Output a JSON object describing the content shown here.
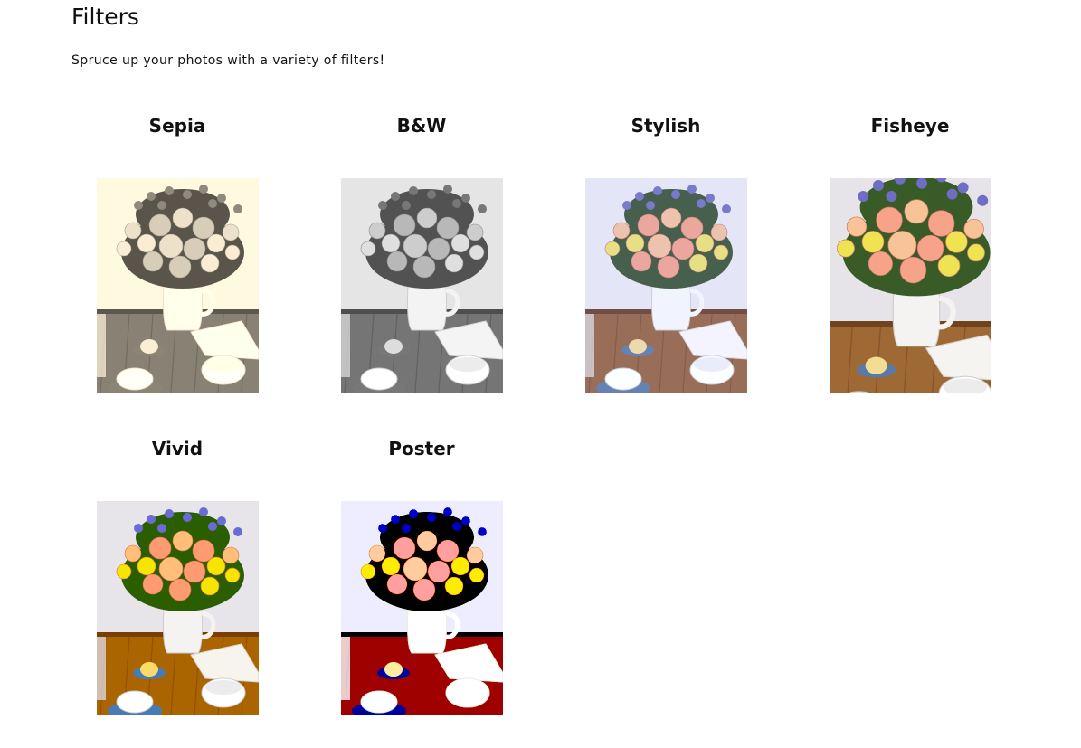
{
  "page": {
    "title": "Filters",
    "subtitle": "Spruce up your photos with a variety of filters!"
  },
  "filters": [
    {
      "id": "sepia",
      "label": "Sepia",
      "filter": "sepia"
    },
    {
      "id": "bw",
      "label": "B&W",
      "filter": "grayscale"
    },
    {
      "id": "stylish",
      "label": "Stylish",
      "filter": "stylish"
    },
    {
      "id": "fisheye",
      "label": "Fisheye",
      "filter": "fisheye"
    },
    {
      "id": "vivid",
      "label": "Vivid",
      "filter": "vivid"
    },
    {
      "id": "poster",
      "label": "Poster",
      "filter": "poster"
    }
  ],
  "photo": {
    "subject": "flower-bouquet-in-white-pitcher-on-wooden-table",
    "colors": {
      "wall": "#e6e4e8",
      "table": "#9b6a3e",
      "table_dark": "#6e4424",
      "pitcher": "#f4f3f2",
      "leaves": "#3b5a2e",
      "rose_pink": "#f2a58e",
      "rose_peach": "#f5c49c",
      "yellow": "#eee36a",
      "blue_flower": "#6f6fbf",
      "saucer_blue": "#5b7aa6",
      "cupcake": "#f1dc9c",
      "napkin": "#f6f4f0"
    }
  }
}
